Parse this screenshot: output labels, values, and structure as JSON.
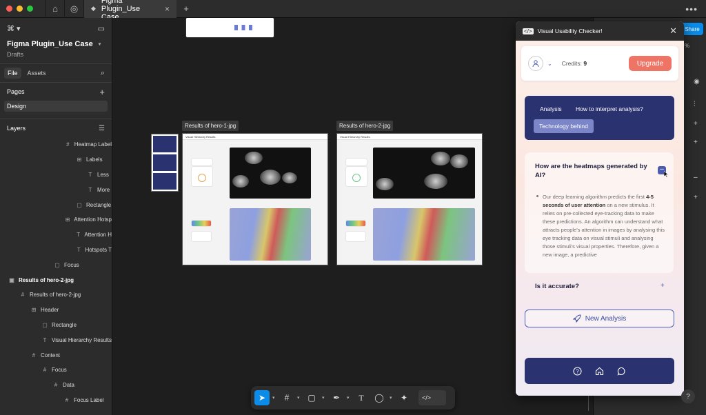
{
  "window": {
    "tab_title": "Figma Plugin_Use Case",
    "tab_close": "×",
    "new_tab": "+",
    "more": "•••"
  },
  "left_sidebar": {
    "file_name": "Figma Plugin_Use Case",
    "location": "Drafts",
    "tabs": [
      "File",
      "Assets"
    ],
    "pages_title": "Pages",
    "pages": [
      "Design"
    ],
    "layers_title": "Layers",
    "layers": [
      {
        "label": "Heatmap Label",
        "icon": "#",
        "indent": 92,
        "bold": false
      },
      {
        "label": "Labels",
        "icon": "⊞",
        "indent": 108,
        "bold": false
      },
      {
        "label": "Less",
        "icon": "T",
        "indent": 124,
        "bold": false
      },
      {
        "label": "More",
        "icon": "T",
        "indent": 124,
        "bold": false
      },
      {
        "label": "Rectangle",
        "icon": "▢",
        "indent": 108,
        "bold": false
      },
      {
        "label": "Attention Hotsp",
        "icon": "⊞",
        "indent": 92,
        "bold": false
      },
      {
        "label": "Attention H",
        "icon": "T",
        "indent": 108,
        "bold": false
      },
      {
        "label": "Hotspots T",
        "icon": "T",
        "indent": 108,
        "bold": false
      },
      {
        "label": "Focus",
        "icon": "▢",
        "indent": 76,
        "bold": false
      },
      {
        "label": "Results of hero-2-jpg",
        "icon": "▣",
        "indent": 10,
        "bold": true
      },
      {
        "label": "Results of hero-2-jpg",
        "icon": "#",
        "indent": 26,
        "bold": false
      },
      {
        "label": "Header",
        "icon": "⊞",
        "indent": 42,
        "bold": false
      },
      {
        "label": "Rectangle",
        "icon": "▢",
        "indent": 58,
        "bold": false
      },
      {
        "label": "Visual Hierarchy Results",
        "icon": "T",
        "indent": 58,
        "bold": false
      },
      {
        "label": "Content",
        "icon": "#",
        "indent": 42,
        "bold": false
      },
      {
        "label": "Focus",
        "icon": "#",
        "indent": 58,
        "bold": false
      },
      {
        "label": "Data",
        "icon": "#",
        "indent": 74,
        "bold": false
      },
      {
        "label": "Focus Label",
        "icon": "#",
        "indent": 90,
        "bold": false
      }
    ]
  },
  "canvas": {
    "frames": [
      {
        "label": "Results of hero-1-jpg",
        "header": "Visual Hierarchy Results"
      },
      {
        "label": "Results of hero-2-jpg",
        "header": "Visual Hierarchy Results"
      }
    ]
  },
  "right_panel": {
    "share_label": "Share",
    "zoom_suffix": "%"
  },
  "plugin": {
    "title": "Visual Usability Checker!",
    "credits_label": "Credits:",
    "credits_value": "9",
    "upgrade_label": "Upgrade",
    "nav_tabs": [
      "Analysis",
      "How to interpret analysis?",
      "Technology behind"
    ],
    "selected_tab": "Technology behind",
    "faq": [
      {
        "question": "How are the heatmaps generated by AI?",
        "expanded": true,
        "answer_pre": "Our deep learning algorithm predicts the first ",
        "answer_bold": "4-5 seconds of user attention",
        "answer_post": " on a new stimulus. It relies on pre-collected eye-tracking data to make these predictions. An algorithm can understand what attracts people's attention in images by analysing this eye tracking data on visual stimuli and analysing those stimuli's visual properties. Therefore, given a new image, a predictive",
        "toggle": "–"
      },
      {
        "question": "Is it accurate?",
        "expanded": false,
        "toggle": "+"
      }
    ],
    "new_analysis_label": "New Analysis",
    "bottom_nav_icons": [
      "help-icon",
      "home-icon",
      "chat-icon"
    ]
  },
  "toolbar": {
    "tools": [
      "move-tool",
      "frame-tool",
      "shape-tool",
      "pen-tool",
      "text-tool",
      "comment-tool",
      "actions-tool",
      "dev-mode-toggle"
    ]
  },
  "help_label": "?",
  "colors": {
    "plugin_navy": "#2b3270",
    "upgrade": "#ee7466",
    "accent_blue": "#0c8ce9"
  }
}
